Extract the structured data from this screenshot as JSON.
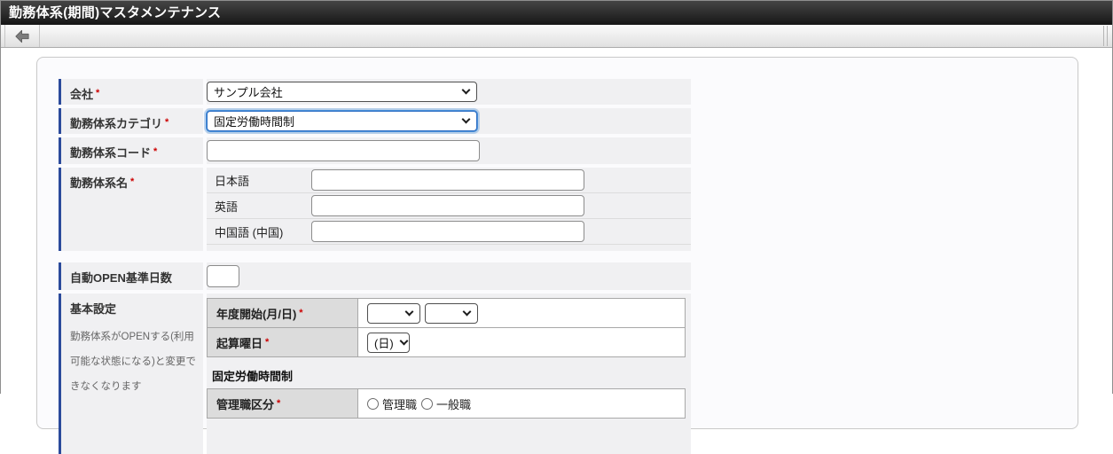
{
  "title_bar": {
    "title": "勤務体系(期間)マスタメンテナンス"
  },
  "toolbar": {
    "back_icon": "back-arrow"
  },
  "colors": {
    "accent_bar": "#2b4a9b",
    "required": "#cc0000",
    "title_bar_bg": "#1f1f1f",
    "focus_ring": "#4a90d9"
  },
  "form": {
    "required_marker": "*",
    "company": {
      "label": "会社",
      "value": "サンプル会社"
    },
    "category": {
      "label": "勤務体系カテゴリ",
      "value": "固定労働時間制",
      "focused": true
    },
    "code": {
      "label": "勤務体系コード",
      "value": ""
    },
    "name": {
      "label": "勤務体系名",
      "fields": [
        {
          "label": "日本語",
          "value": ""
        },
        {
          "label": "英語",
          "value": ""
        },
        {
          "label": "中国語 (中国)",
          "value": ""
        }
      ]
    },
    "auto_open_days": {
      "label": "自動OPEN基準日数",
      "value": ""
    },
    "basic_settings": {
      "label": "基本設定",
      "note": "勤務体系がOPENする(利用可能な状態になる)と変更できなくなります",
      "year_start": {
        "label": "年度開始(月/日)",
        "month_value": "",
        "day_value": ""
      },
      "start_weekday": {
        "label": "起算曜日",
        "value": "(日)"
      },
      "subsection": "固定労働時間制",
      "manager_class": {
        "label": "管理職区分",
        "options": [
          {
            "label": "管理職",
            "checked": false
          },
          {
            "label": "一般職",
            "checked": false
          }
        ]
      }
    }
  }
}
